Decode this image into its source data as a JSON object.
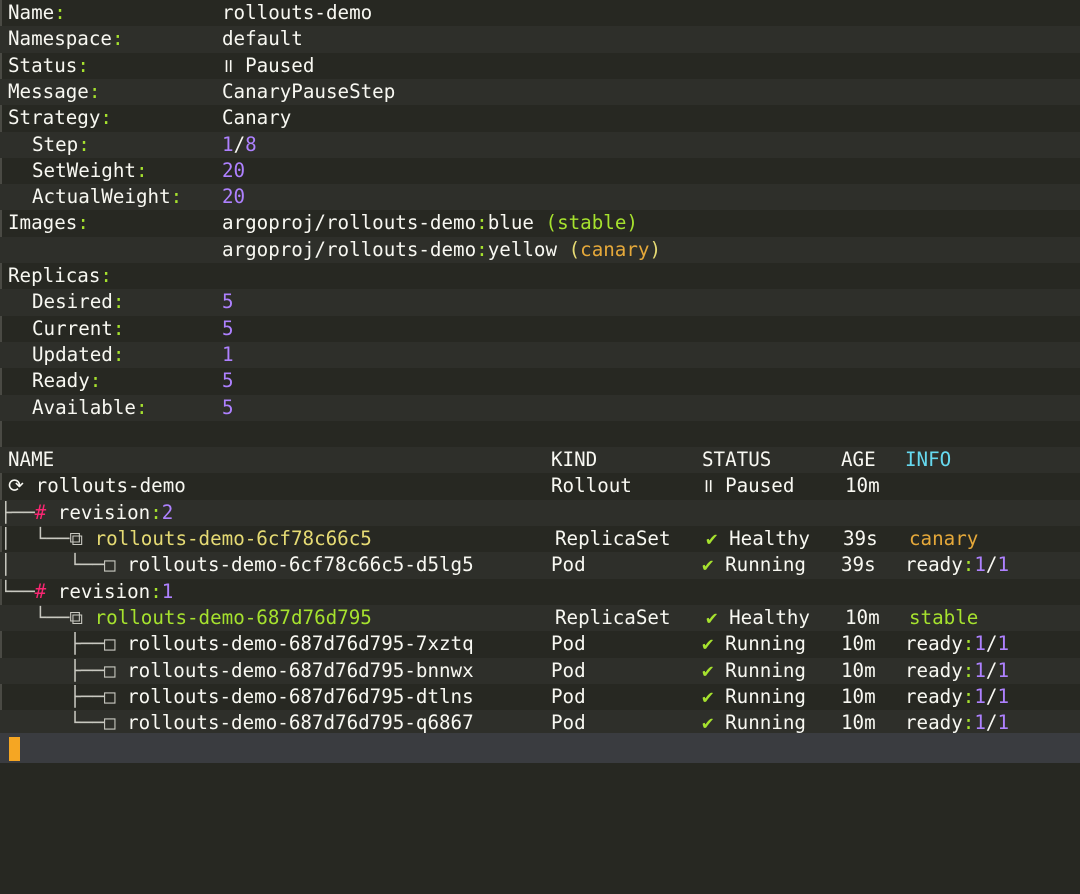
{
  "details": {
    "name_label": "Name",
    "name_value": "rollouts-demo",
    "namespace_label": "Namespace",
    "namespace_value": "default",
    "status_label": "Status",
    "status_icon": "॥",
    "status_value": "Paused",
    "message_label": "Message",
    "message_value": "CanaryPauseStep",
    "strategy_label": "Strategy",
    "strategy_value": "Canary",
    "step_label": "Step",
    "step_current": "1",
    "step_total": "8",
    "setweight_label": "SetWeight",
    "setweight_value": "20",
    "actualweight_label": "ActualWeight",
    "actualweight_value": "20",
    "images_label": "Images",
    "image1_repo": "argoproj/rollouts-demo",
    "image1_tag": "blue",
    "image1_role": "stable",
    "image2_repo": "argoproj/rollouts-demo",
    "image2_tag": "yellow",
    "image2_role": "canary",
    "replicas_label": "Replicas",
    "desired_label": "Desired",
    "desired_value": "5",
    "current_label": "Current",
    "current_value": "5",
    "updated_label": "Updated",
    "updated_value": "1",
    "ready_label": "Ready",
    "ready_value": "5",
    "available_label": "Available",
    "available_value": "5"
  },
  "table": {
    "headers": {
      "name": "NAME",
      "kind": "KIND",
      "status": "STATUS",
      "age": "AGE",
      "info": "INFO"
    },
    "rollout": {
      "icon": "⟳",
      "name": "rollouts-demo",
      "kind": "Rollout",
      "status_icon": "॥",
      "status": "Paused",
      "age": "10m"
    },
    "revision2": {
      "prefix": "├──",
      "hash": "#",
      "label": "revision",
      "num": "2"
    },
    "rs2": {
      "prefix": "│  └──",
      "icon": "⧉",
      "name": "rollouts-demo-6cf78c66c5",
      "kind": "ReplicaSet",
      "status_icon": "✔",
      "status": "Healthy",
      "age": "39s",
      "info": "canary"
    },
    "pod2": {
      "prefix": "│     └──",
      "icon": "□",
      "name": "rollouts-demo-6cf78c66c5-d5lg5",
      "kind": "Pod",
      "status_icon": "✔",
      "status": "Running",
      "age": "39s",
      "info_label": "ready",
      "info_ready": "1",
      "info_total": "1"
    },
    "revision1": {
      "prefix": "└──",
      "hash": "#",
      "label": "revision",
      "num": "1"
    },
    "rs1": {
      "prefix": "   └──",
      "icon": "⧉",
      "name": "rollouts-demo-687d76d795",
      "kind": "ReplicaSet",
      "status_icon": "✔",
      "status": "Healthy",
      "age": "10m",
      "info": "stable"
    },
    "pods1": [
      {
        "prefix": "      ├──",
        "icon": "□",
        "name": "rollouts-demo-687d76d795-7xztq",
        "kind": "Pod",
        "status_icon": "✔",
        "status": "Running",
        "age": "10m",
        "info_label": "ready",
        "info_ready": "1",
        "info_total": "1"
      },
      {
        "prefix": "      ├──",
        "icon": "□",
        "name": "rollouts-demo-687d76d795-bnnwx",
        "kind": "Pod",
        "status_icon": "✔",
        "status": "Running",
        "age": "10m",
        "info_label": "ready",
        "info_ready": "1",
        "info_total": "1"
      },
      {
        "prefix": "      ├──",
        "icon": "□",
        "name": "rollouts-demo-687d76d795-dtlns",
        "kind": "Pod",
        "status_icon": "✔",
        "status": "Running",
        "age": "10m",
        "info_label": "ready",
        "info_ready": "1",
        "info_total": "1"
      },
      {
        "prefix": "      └──",
        "icon": "□",
        "name": "rollouts-demo-687d76d795-q6867",
        "kind": "Pod",
        "status_icon": "✔",
        "status": "Running",
        "age": "10m",
        "info_label": "ready",
        "info_ready": "1",
        "info_total": "1"
      }
    ]
  },
  "colors": {
    "accent_green": "#a6e22e",
    "accent_purple": "#ae81ff",
    "accent_yellow": "#e6db74",
    "accent_blue": "#66d9ef",
    "cursor": "#f5a623"
  }
}
